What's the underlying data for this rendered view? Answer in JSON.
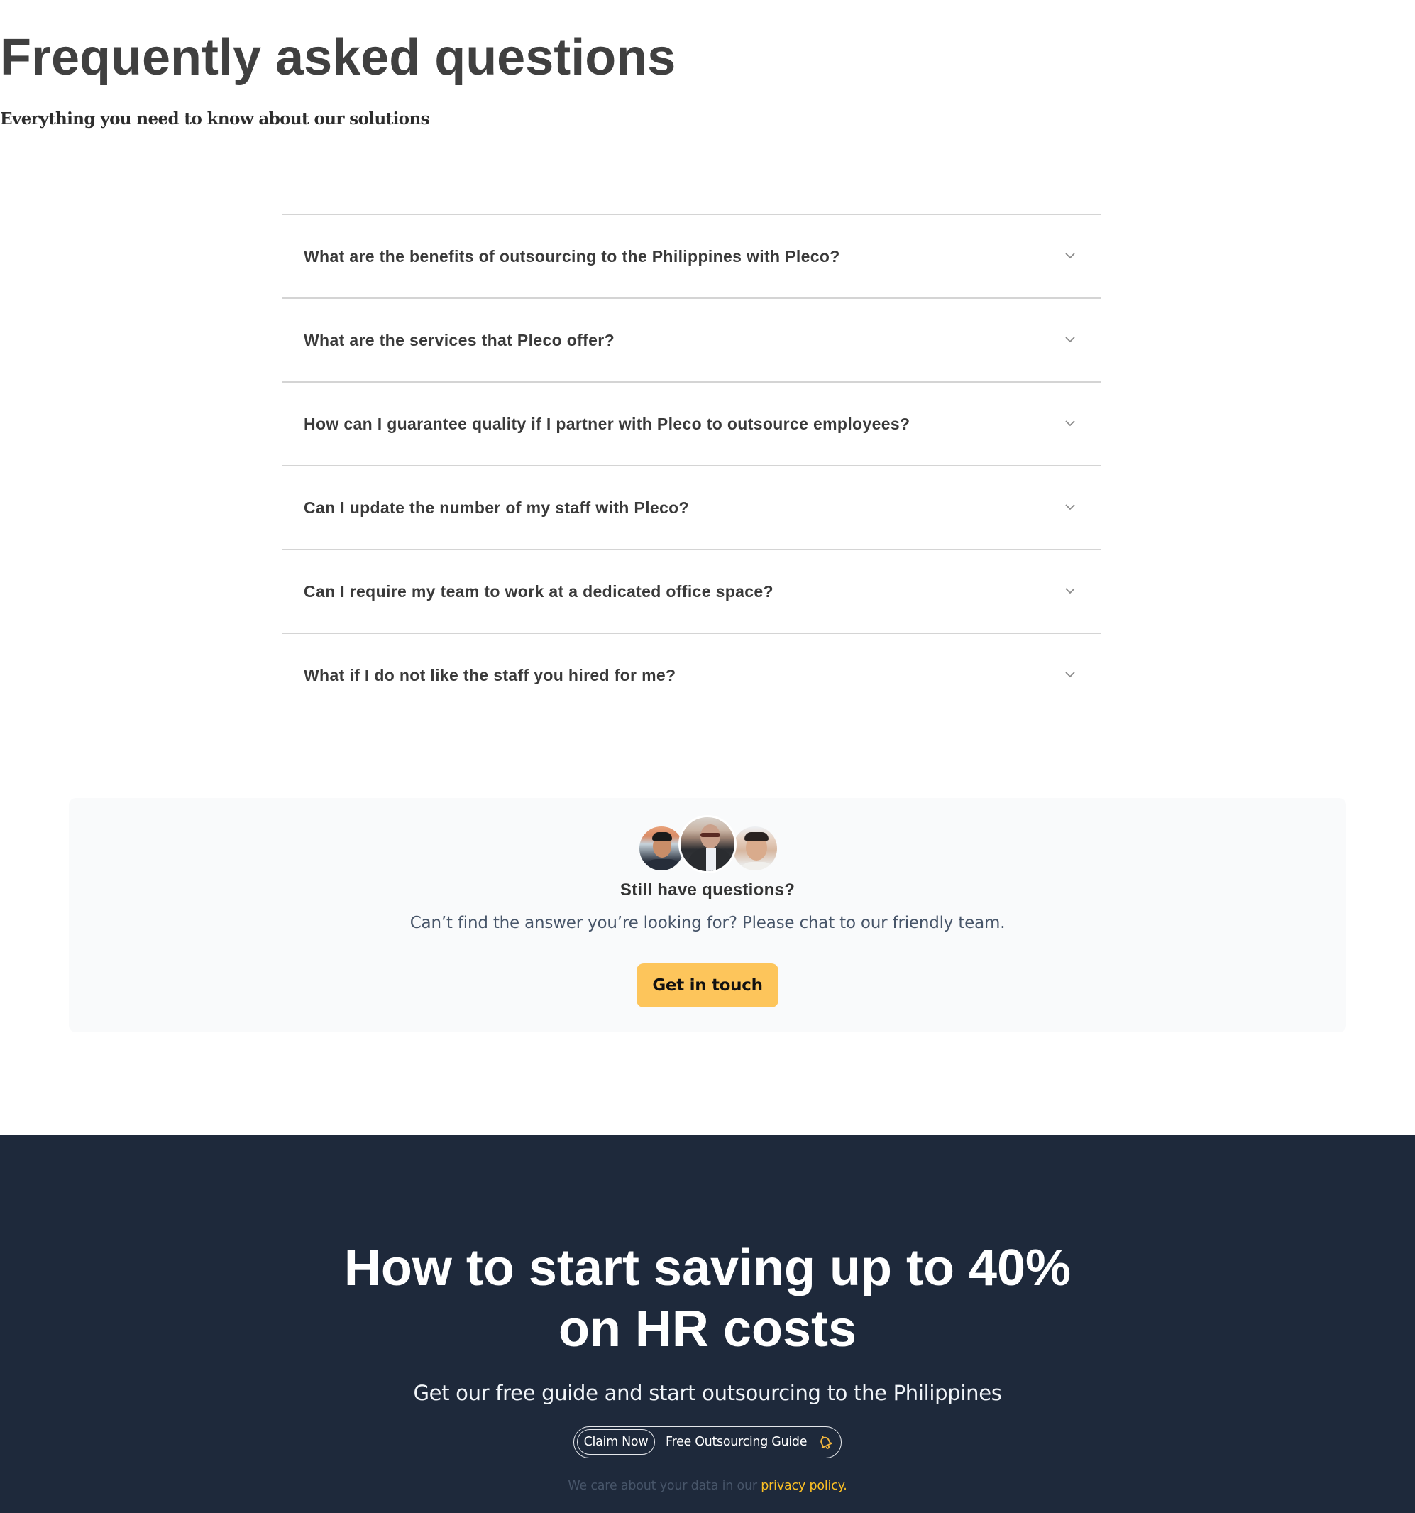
{
  "faq": {
    "title": "Frequently asked questions",
    "subtitle": "Everything you need to know about our solutions",
    "items": [
      {
        "question": "What are the benefits of outsourcing to the Philippines with Pleco?",
        "icon": "chevron-down-icon",
        "expanded": false
      },
      {
        "question": "What are the services that Pleco offer?",
        "icon": "chevron-down-icon",
        "expanded": false
      },
      {
        "question": "How can I guarantee quality if I partner with Pleco to outsource employees?",
        "icon": "chevron-down-icon",
        "expanded": false
      },
      {
        "question": "Can I update the number of my staff with Pleco?",
        "icon": "chevron-down-icon",
        "expanded": false
      },
      {
        "question": "Can I require my team to work at a dedicated office space?",
        "icon": "chevron-down-icon",
        "expanded": false
      },
      {
        "question": "What if I do not like the staff you hired for me?",
        "icon": "chevron-down-icon",
        "expanded": false
      }
    ]
  },
  "cta": {
    "avatars": [
      "team-member-avatar",
      "team-member-avatar",
      "team-member-avatar"
    ],
    "title": "Still have questions?",
    "description": "Can’t find the answer you’re looking for? Please chat to our friendly team.",
    "button_label": "Get in touch",
    "button_color": "#fdc55b"
  },
  "promo": {
    "title_line1": "How to start saving up to 40%",
    "title_line2": "on HR costs",
    "subtitle": "Get our free guide and start outsourcing to the Philippines",
    "claim_now_label": "Claim Now",
    "guide_label": "Free Outsourcing Guide",
    "guide_icon": "bell-icon",
    "privacy_text": "We care about your data in our ",
    "privacy_link": "privacy policy.",
    "background_color": "#1e293b",
    "accent_color": "#fbbf24"
  }
}
